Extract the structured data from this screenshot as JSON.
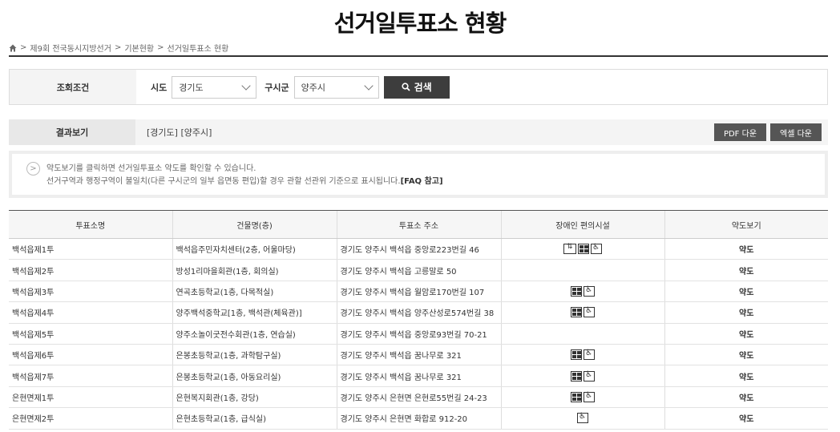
{
  "page": {
    "title": "선거일투표소 현황"
  },
  "breadcrumb": {
    "icon": "home-icon",
    "items": [
      "제9회 전국동시지방선거",
      "기본현황",
      "선거일투표소 현황"
    ],
    "separator": ">"
  },
  "search": {
    "label": "조회조건",
    "sido_label": "시도",
    "sido_value": "경기도",
    "gusigun_label": "구시군",
    "gusigun_value": "양주시",
    "button_label": "검색"
  },
  "result": {
    "label": "결과보기",
    "text": "[경기도] [양주시]",
    "pdf_label": "PDF 다운",
    "excel_label": "엑셀 다운"
  },
  "notice": {
    "line1": "약도보기를 클릭하면 선거일투표소 약도를 확인할 수 있습니다.",
    "line2": "선거구역과 행정구역이 불일치(다른 구시군의 일부 읍면동 편입)할 경우 관할 선관위 기준으로 표시됩니다.",
    "faq": "[FAQ 참고]"
  },
  "table": {
    "headers": [
      "투표소명",
      "건물명(층)",
      "투표소 주소",
      "장애인 편의시설",
      "약도보기"
    ],
    "rows": [
      {
        "name": "백석읍제1투",
        "building": "백석읍주민자치센터(2층, 어울마당)",
        "address": "경기도 양주시 백석읍 중앙로223번길 46",
        "facilities": [
          "elevator-icon",
          "grid-icon",
          "wheelchair-icon"
        ],
        "map": "약도"
      },
      {
        "name": "백석읍제2투",
        "building": "방성1리마을회관(1층, 회의실)",
        "address": "경기도 양주시 백석읍 고릉말로 50",
        "facilities": [],
        "map": "약도"
      },
      {
        "name": "백석읍제3투",
        "building": "연곡초등학교(1층, 다목적실)",
        "address": "경기도 양주시 백석읍 월암로170번길 107",
        "facilities": [
          "grid-icon",
          "wheelchair-icon"
        ],
        "map": "약도"
      },
      {
        "name": "백석읍제4투",
        "building": "양주백석중학교[1층, 백석관(체육관)]",
        "address": "경기도 양주시 백석읍 양주산성로574번길 38",
        "facilities": [
          "grid-icon",
          "wheelchair-icon"
        ],
        "map": "약도"
      },
      {
        "name": "백석읍제5투",
        "building": "양주소놀이굿전수회관(1층, 연습실)",
        "address": "경기도 양주시 백석읍 중앙로93번길 70-21",
        "facilities": [],
        "map": "약도"
      },
      {
        "name": "백석읍제6투",
        "building": "은봉초등학교(1층, 과학탐구실)",
        "address": "경기도 양주시 백석읍 꿈나무로 321",
        "facilities": [
          "grid-icon",
          "wheelchair-icon"
        ],
        "map": "약도"
      },
      {
        "name": "백석읍제7투",
        "building": "은봉초등학교(1층, 아동요리실)",
        "address": "경기도 양주시 백석읍 꿈나무로 321",
        "facilities": [
          "grid-icon",
          "wheelchair-icon"
        ],
        "map": "약도"
      },
      {
        "name": "은현면제1투",
        "building": "은현복지회관(1층, 강당)",
        "address": "경기도 양주시 은현면 은현로55번길 24-23",
        "facilities": [
          "grid-icon",
          "wheelchair-icon"
        ],
        "map": "약도"
      },
      {
        "name": "은현면제2투",
        "building": "은현초등학교(1층, 급식실)",
        "address": "경기도 양주시 은현면 화합로 912-20",
        "facilities": [
          "wheelchair-icon"
        ],
        "map": "약도"
      }
    ]
  }
}
